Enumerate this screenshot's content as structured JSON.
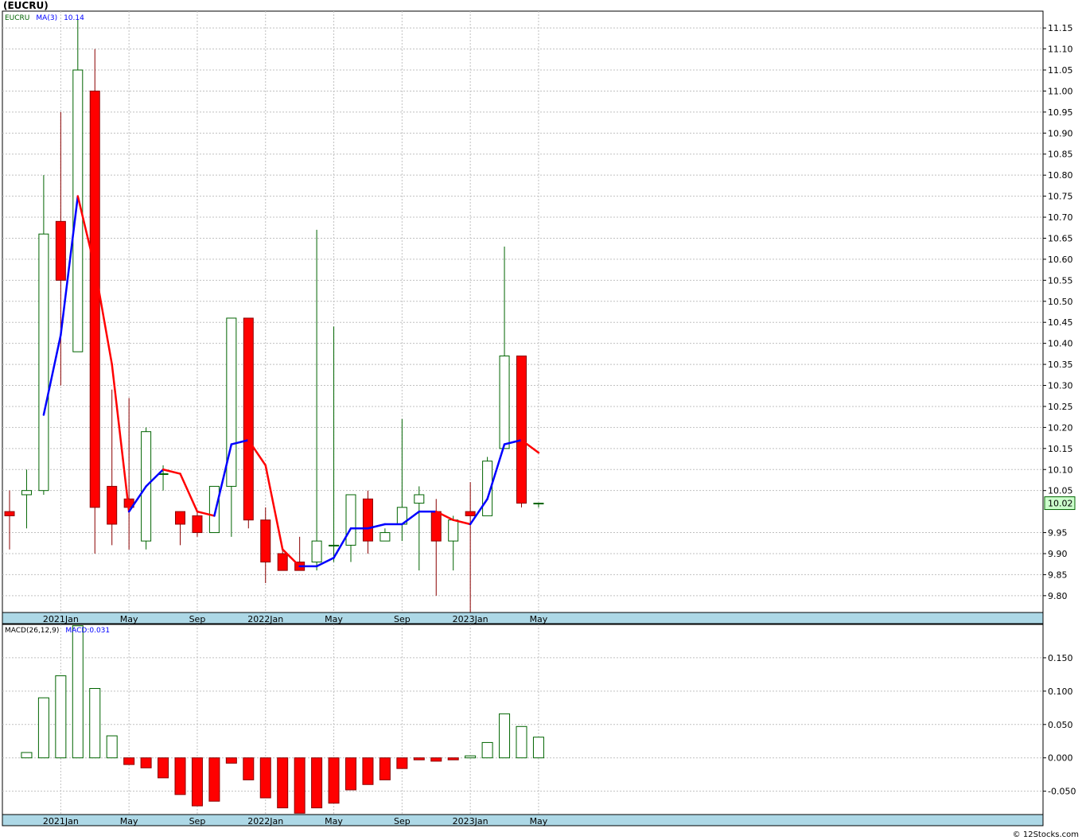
{
  "title": "(EUCRU)",
  "credit": "© 12Stocks.com",
  "colors": {
    "up": "#006400",
    "down": "#ff0000",
    "ma_up": "#0000ff",
    "ma_down": "#ff0000",
    "axis_band": "#add8e6",
    "grid": "#c0c0c0"
  },
  "chart_data": [
    {
      "type": "candlestick",
      "legend": {
        "symbol": "EUCRU",
        "ma_label": "MA(3)",
        "ma_value": "10.14"
      },
      "last_price_label": "10.02",
      "ylim": [
        9.76,
        11.19
      ],
      "y_ticks": [
        "9.80",
        "9.85",
        "9.90",
        "9.95",
        "10.05",
        "10.10",
        "10.15",
        "10.20",
        "10.25",
        "10.30",
        "10.35",
        "10.40",
        "10.45",
        "10.50",
        "10.55",
        "10.60",
        "10.65",
        "10.70",
        "10.75",
        "10.80",
        "10.85",
        "10.90",
        "10.95",
        "11.00",
        "11.05",
        "11.10",
        "11.15"
      ],
      "x_labels": [
        "2021Jan",
        "May",
        "Sep",
        "2022Jan",
        "May",
        "Sep",
        "2023Jan",
        "May"
      ],
      "x_label_months": [
        3,
        7,
        11,
        15,
        19,
        23,
        27,
        31
      ],
      "months": [
        "2020-10",
        "2020-11",
        "2020-12",
        "2021-01",
        "2021-02",
        "2021-03",
        "2021-04",
        "2021-05",
        "2021-06",
        "2021-07",
        "2021-08",
        "2021-09",
        "2021-10",
        "2021-11",
        "2021-12",
        "2022-01",
        "2022-02",
        "2022-03",
        "2022-04",
        "2022-05",
        "2022-06",
        "2022-07",
        "2022-08",
        "2022-09",
        "2022-10",
        "2022-11",
        "2022-12",
        "2023-01",
        "2023-02",
        "2023-03",
        "2023-04",
        "2023-05"
      ],
      "ohlc": [
        [
          10.0,
          10.05,
          9.91,
          9.99
        ],
        [
          10.04,
          10.1,
          9.96,
          10.05
        ],
        [
          10.05,
          10.8,
          10.04,
          10.66
        ],
        [
          10.69,
          10.95,
          10.3,
          10.55
        ],
        [
          10.38,
          11.17,
          10.38,
          11.05
        ],
        [
          11.0,
          11.1,
          9.9,
          10.01
        ],
        [
          10.06,
          10.29,
          9.92,
          9.97
        ],
        [
          10.03,
          10.27,
          9.91,
          10.01
        ],
        [
          9.93,
          10.2,
          9.91,
          10.19
        ],
        [
          10.09,
          10.11,
          10.05,
          10.09
        ],
        [
          10.0,
          10.0,
          9.92,
          9.97
        ],
        [
          9.99,
          10.0,
          9.94,
          9.95
        ],
        [
          9.95,
          10.06,
          9.95,
          10.06
        ],
        [
          10.06,
          10.46,
          9.94,
          10.46
        ],
        [
          10.46,
          10.46,
          9.96,
          9.98
        ],
        [
          9.98,
          10.01,
          9.83,
          9.88
        ],
        [
          9.9,
          9.91,
          9.86,
          9.86
        ],
        [
          9.88,
          9.94,
          9.86,
          9.86
        ],
        [
          9.88,
          10.67,
          9.86,
          9.93
        ],
        [
          9.92,
          10.44,
          9.88,
          9.92
        ],
        [
          9.92,
          10.04,
          9.88,
          10.04
        ],
        [
          10.03,
          10.05,
          9.9,
          9.93
        ],
        [
          9.93,
          9.96,
          9.93,
          9.95
        ],
        [
          9.97,
          10.22,
          9.93,
          10.01
        ],
        [
          10.02,
          10.06,
          9.86,
          10.04
        ],
        [
          10.0,
          10.03,
          9.8,
          9.93
        ],
        [
          9.93,
          9.99,
          9.86,
          9.98
        ],
        [
          10.0,
          10.07,
          9.76,
          9.99
        ],
        [
          9.99,
          10.13,
          9.99,
          10.12
        ],
        [
          10.15,
          10.63,
          10.15,
          10.37
        ],
        [
          10.37,
          10.37,
          10.01,
          10.02
        ],
        [
          10.02,
          10.02,
          10.01,
          10.02
        ]
      ],
      "ma3": [
        null,
        null,
        10.23,
        10.42,
        10.75,
        10.58,
        10.35,
        10.0,
        10.06,
        10.1,
        10.09,
        10.0,
        9.99,
        10.16,
        10.17,
        10.11,
        9.91,
        9.87,
        9.87,
        9.89,
        9.96,
        9.96,
        9.97,
        9.97,
        10.0,
        10.0,
        9.98,
        9.97,
        10.03,
        10.16,
        10.17,
        10.14
      ]
    },
    {
      "type": "bar",
      "legend": {
        "name": "MACD(26,12,9)",
        "value_label": "MACD:0.031"
      },
      "ylim": [
        -0.085,
        0.2
      ],
      "y_ticks": [
        "-0.050",
        "0.000",
        "0.050",
        "0.100",
        "0.150"
      ],
      "x_labels": [
        "2021Jan",
        "May",
        "Sep",
        "2022Jan",
        "May",
        "Sep",
        "2023Jan",
        "May"
      ],
      "values": [
        null,
        0.008,
        0.09,
        0.123,
        0.198,
        0.104,
        0.033,
        -0.01,
        -0.015,
        -0.03,
        -0.055,
        -0.072,
        -0.065,
        -0.008,
        -0.033,
        -0.06,
        -0.075,
        -0.083,
        -0.075,
        -0.068,
        -0.048,
        -0.04,
        -0.033,
        -0.016,
        -0.003,
        -0.005,
        -0.003,
        0.003,
        0.023,
        0.066,
        0.047,
        0.031
      ]
    }
  ]
}
